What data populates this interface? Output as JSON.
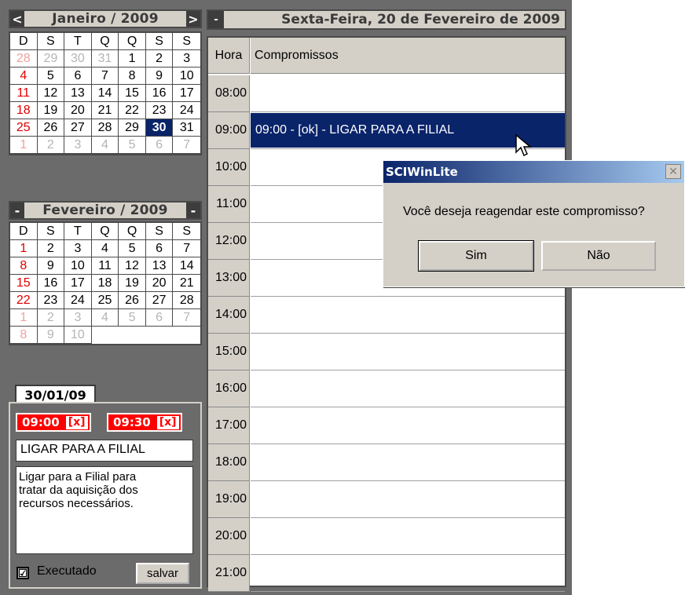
{
  "cal1": {
    "title": "Janeiro / 2009",
    "prev": "<",
    "next": ">",
    "days_header": [
      "D",
      "S",
      "T",
      "Q",
      "Q",
      "S",
      "S"
    ],
    "cells": [
      "28",
      "29",
      "30",
      "31",
      "1",
      "2",
      "3",
      "4",
      "5",
      "6",
      "7",
      "8",
      "9",
      "10",
      "11",
      "12",
      "13",
      "14",
      "15",
      "16",
      "17",
      "18",
      "19",
      "20",
      "21",
      "22",
      "23",
      "24",
      "25",
      "26",
      "27",
      "28",
      "29",
      "30",
      "31",
      "1",
      "2",
      "3",
      "4",
      "5",
      "6",
      "7"
    ],
    "selected": "30"
  },
  "cal2": {
    "title": "Fevereiro / 2009",
    "prev": "-",
    "next": "-",
    "days_header": [
      "D",
      "S",
      "T",
      "Q",
      "Q",
      "S",
      "S"
    ],
    "cells": [
      "1",
      "2",
      "3",
      "4",
      "5",
      "6",
      "7",
      "8",
      "9",
      "10",
      "11",
      "12",
      "13",
      "14",
      "15",
      "16",
      "17",
      "18",
      "19",
      "20",
      "21",
      "22",
      "23",
      "24",
      "25",
      "26",
      "27",
      "28",
      "1",
      "2",
      "3",
      "4",
      "5",
      "6",
      "7",
      "8",
      "9",
      "10"
    ]
  },
  "appointment": {
    "date": "30/01/09",
    "start": "09:00",
    "end": "09:30",
    "x_label": "[x]",
    "title": "LIGAR PARA A FILIAL",
    "desc_lines": [
      "Ligar para a Filial para",
      "tratar da aquisição dos",
      "recursos necessários."
    ],
    "executed_label": "Executado",
    "executed_check": "☑",
    "save_label": "salvar"
  },
  "day": {
    "collapse": "-",
    "title": "Sexta-Feira, 20 de Fevereiro de 2009",
    "col_hora": "Hora",
    "col_comp": "Compromissos",
    "hours": [
      "08:00",
      "09:00",
      "10:00",
      "11:00",
      "12:00",
      "13:00",
      "14:00",
      "15:00",
      "16:00",
      "17:00",
      "18:00",
      "19:00",
      "20:00",
      "21:00"
    ],
    "appointment_text": "09:00 - [ok] - LIGAR PARA A FILIAL"
  },
  "dialog": {
    "title": "SCIWinLite",
    "close": "✕",
    "message": "Você deseja reagendar este compromisso?",
    "yes": "Sim",
    "no": "Não"
  },
  "colors": {
    "selection": "#0a246a",
    "sunday": "#e00000",
    "panel": "#6b6b6b",
    "button_face": "#d4d0c8"
  }
}
